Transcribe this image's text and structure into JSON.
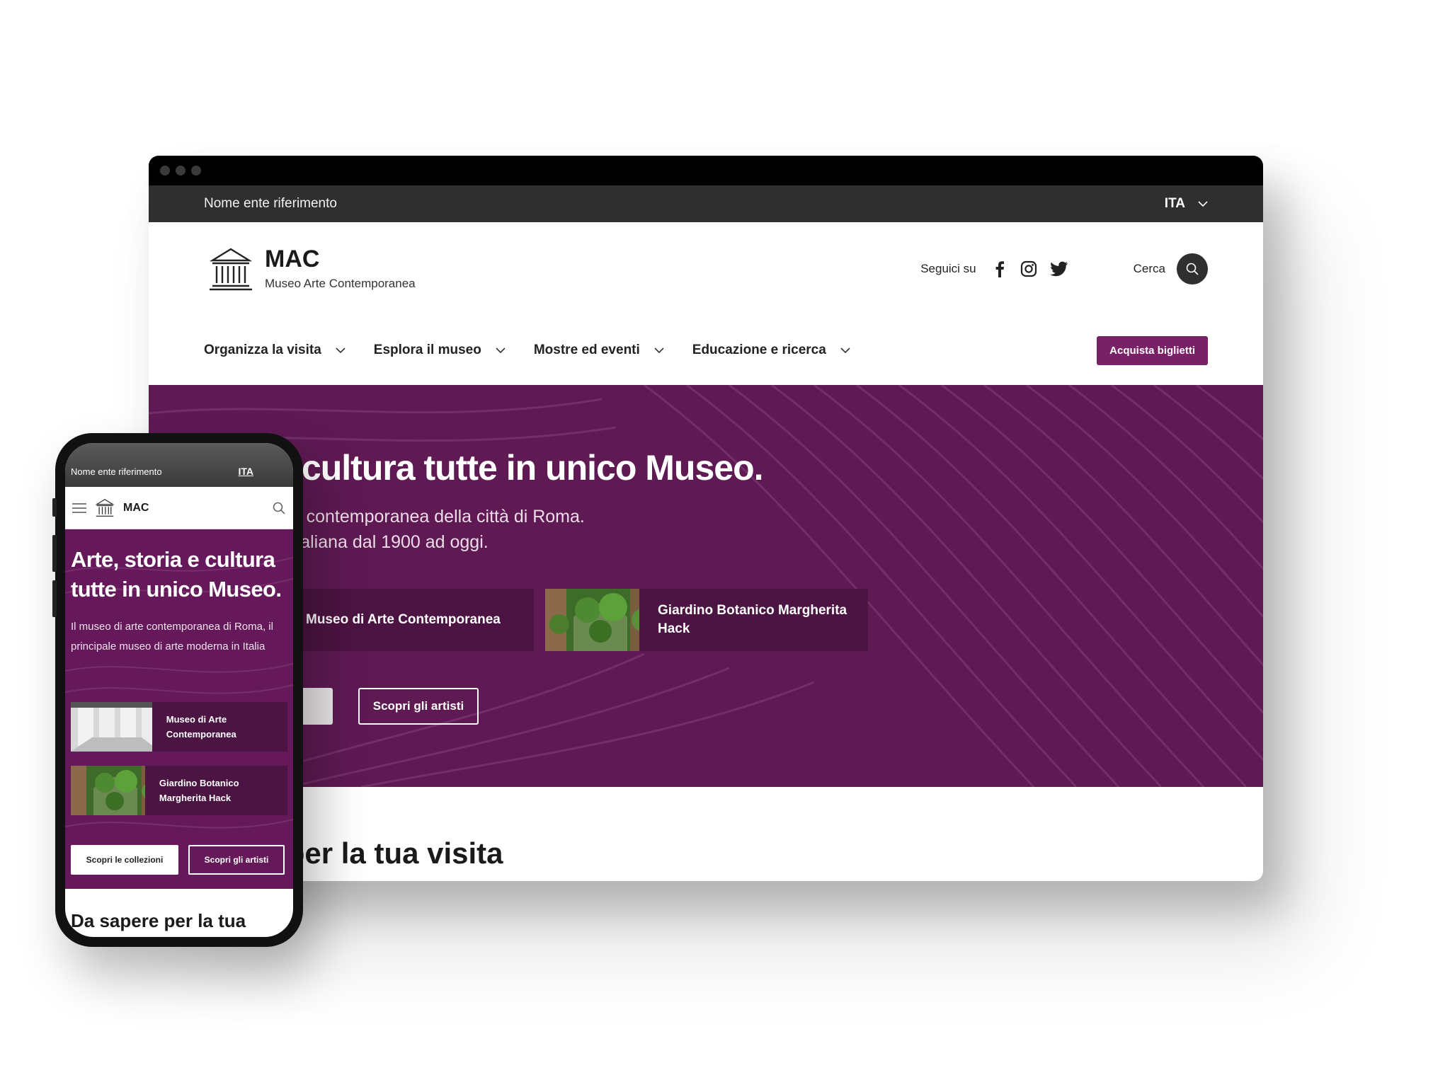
{
  "desktop": {
    "slim_header": {
      "ente": "Nome ente riferimento",
      "lang": "ITA"
    },
    "brand": {
      "title": "MAC",
      "subtitle": "Museo Arte Contemporanea"
    },
    "social": {
      "label": "Seguici su",
      "icons": [
        "facebook-icon",
        "instagram-icon",
        "twitter-icon"
      ]
    },
    "search": {
      "label": "Cerca"
    },
    "nav": {
      "items": [
        {
          "label": "Organizza la visita"
        },
        {
          "label": "Esplora il museo"
        },
        {
          "label": "Mostre ed eventi"
        },
        {
          "label": "Educazione e ricerca"
        }
      ],
      "cta": "Acquista biglietti"
    },
    "hero": {
      "title": "toria e cultura tutte in unico Museo.",
      "desc_line1": "rte moderna e contemporanea della città di Roma.",
      "desc_line2": "oria artistica italiana dal 1900 ad oggi.",
      "cards": [
        {
          "title": "Museo di Arte Contemporanea"
        },
        {
          "title": "Giardino Botanico Margherita Hack"
        }
      ],
      "buttons": {
        "collections": "oni",
        "artists": "Scopri gli artisti"
      }
    },
    "section_title": "ere per la tua visita"
  },
  "mobile": {
    "slim_header": {
      "ente": "Nome ente riferimento",
      "lang": "ITA"
    },
    "brand": "MAC",
    "hero": {
      "title": "Arte, storia e cultura tutte in unico Museo.",
      "desc": "Il museo di arte contemporanea di Roma, il principale museo di arte moderna in Italia",
      "cards": [
        {
          "title": "Museo di Arte Contemporanea"
        },
        {
          "title": "Giardino Botanico Margherita Hack"
        }
      ],
      "buttons": {
        "collections": "Scopri le collezioni",
        "artists": "Scopri gli artisti"
      }
    },
    "section_title": "Da sapere per la tua"
  },
  "colors": {
    "primary": "#782167",
    "hero_bg": "#5f1a54",
    "card_bg": "#4c1442",
    "slim_header": "#2f2f2f"
  }
}
